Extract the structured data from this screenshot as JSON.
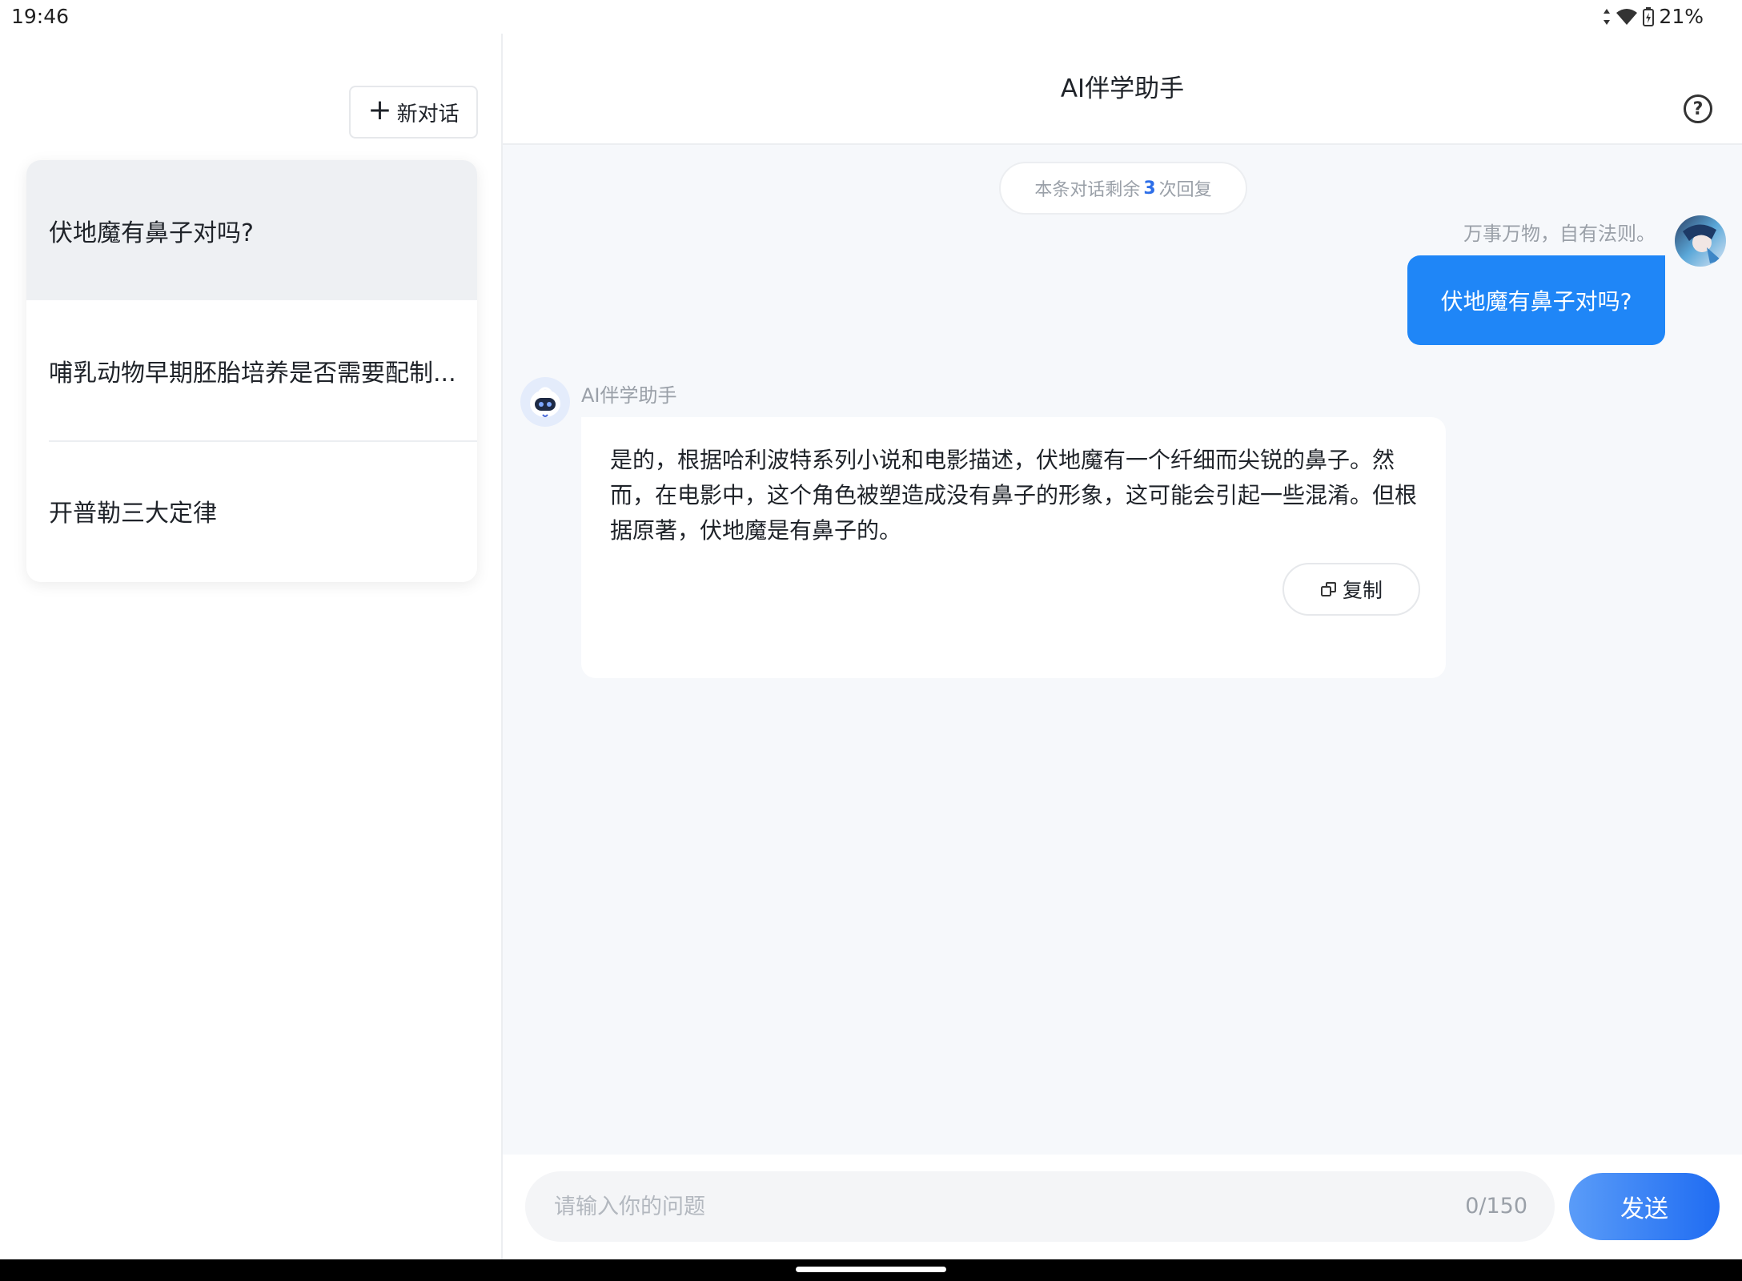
{
  "status_bar": {
    "time": "19:46",
    "battery": "21%",
    "icons": [
      "data-arrows-icon",
      "wifi-icon",
      "battery-icon"
    ]
  },
  "sidebar": {
    "new_chat_label": "新对话",
    "history": [
      {
        "title": "伏地魔有鼻子对吗?",
        "active": true
      },
      {
        "title": "哺乳动物早期胚胎培养是否需要配制...",
        "active": false
      },
      {
        "title": "开普勒三大定律",
        "active": false
      }
    ]
  },
  "header": {
    "title": "AI伴学助手",
    "help_icon": "question-circle-icon"
  },
  "chat": {
    "remaining_prefix": "本条对话剩余",
    "remaining_count": "3",
    "remaining_suffix": "次回复",
    "user": {
      "name": "万事万物，自有法则。",
      "message": "伏地魔有鼻子对吗?"
    },
    "assistant": {
      "name": "AI伴学助手",
      "message": "是的，根据哈利波特系列小说和电影描述，伏地魔有一个纤细而尖锐的鼻子。然而，在电影中，这个角色被塑造成没有鼻子的形象，这可能会引起一些混淆。但根据原著，伏地魔是有鼻子的。",
      "copy_label": "复制"
    }
  },
  "input": {
    "placeholder": "请输入你的问题",
    "value": "",
    "counter": "0/150",
    "send_label": "发送"
  },
  "colors": {
    "accent": "#1f86f7",
    "send_gradient_start": "#5a9cf8",
    "send_gradient_end": "#1f6cf2",
    "muted_text": "#9aa0a8",
    "chat_background": "#f6f8fb"
  }
}
